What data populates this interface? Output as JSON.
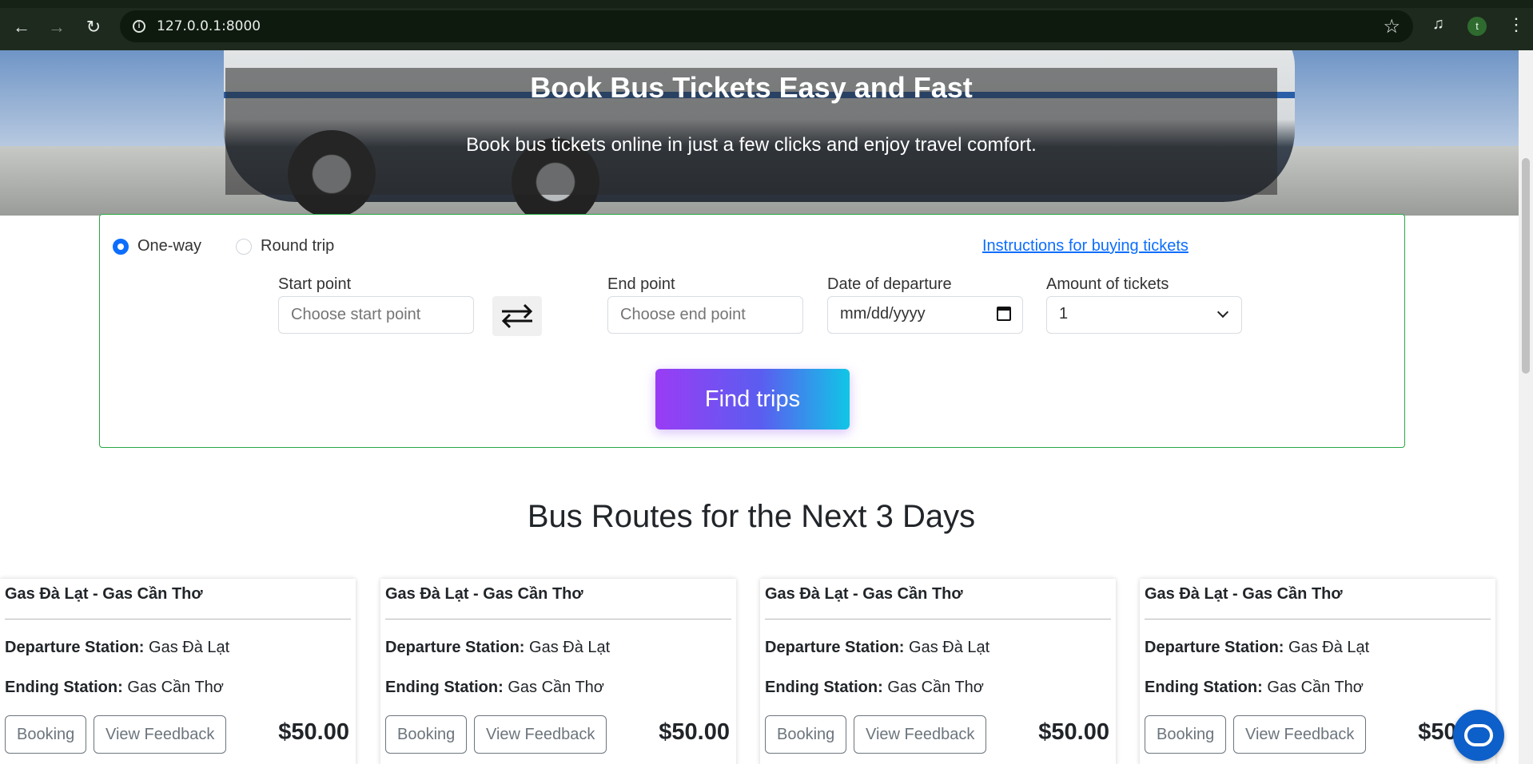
{
  "browser": {
    "url": "127.0.0.1:8000",
    "profile_initial": "t",
    "icons": [
      "back-icon",
      "forward-icon",
      "reload-icon",
      "info-icon",
      "star-icon",
      "media-icon",
      "menu-icon"
    ]
  },
  "hero": {
    "title": "Book Bus Tickets Easy and Fast",
    "subtitle": "Book bus tickets online in just a few clicks and enjoy travel comfort."
  },
  "search": {
    "trip_types": [
      {
        "label": "One-way",
        "checked": true
      },
      {
        "label": "Round trip",
        "checked": false
      }
    ],
    "instructions_link": "Instructions for buying tickets",
    "start_label": "Start point",
    "start_placeholder": "Choose start point",
    "end_label": "End point",
    "end_placeholder": "Choose end point",
    "date_label": "Date of departure",
    "date_placeholder": "mm/dd/yyyy",
    "amount_label": "Amount of tickets",
    "amount_value": "1",
    "find_button": "Find trips",
    "accent_color": "#28a745"
  },
  "routes": {
    "title": "Bus Routes for the Next 3 Days",
    "cards": [
      {
        "title": "Gas Đà Lạt - Gas Cần Thơ",
        "departure_label": "Departure Station:",
        "departure": "Gas Đà Lạt",
        "ending_label": "Ending Station:",
        "ending": "Gas Cần Thơ",
        "booking": "Booking",
        "feedback": "View Feedback",
        "price": "$50.00"
      },
      {
        "title": "Gas Đà Lạt - Gas Cần Thơ",
        "departure_label": "Departure Station:",
        "departure": "Gas Đà Lạt",
        "ending_label": "Ending Station:",
        "ending": "Gas Cần Thơ",
        "booking": "Booking",
        "feedback": "View Feedback",
        "price": "$50.00"
      },
      {
        "title": "Gas Đà Lạt - Gas Cần Thơ",
        "departure_label": "Departure Station:",
        "departure": "Gas Đà Lạt",
        "ending_label": "Ending Station:",
        "ending": "Gas Cần Thơ",
        "booking": "Booking",
        "feedback": "View Feedback",
        "price": "$50.00"
      },
      {
        "title": "Gas Đà Lạt - Gas Cần Thơ",
        "departure_label": "Departure Station:",
        "departure": "Gas Đà Lạt",
        "ending_label": "Ending Station:",
        "ending": "Gas Cần Thơ",
        "booking": "Booking",
        "feedback": "View Feedback",
        "price": "$50.00"
      }
    ]
  },
  "chat": {
    "icon": "chat-icon",
    "color": "#0d5fc9"
  }
}
